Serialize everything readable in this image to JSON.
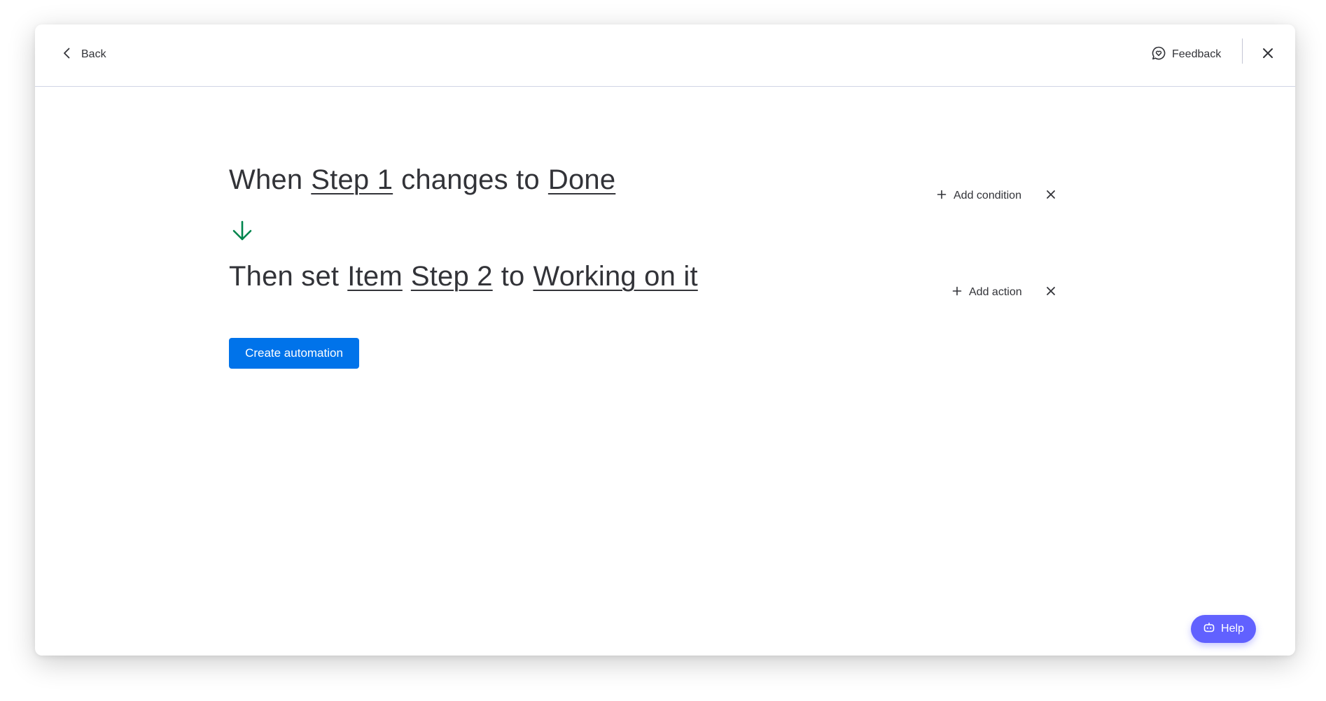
{
  "header": {
    "back_label": "Back",
    "feedback_label": "Feedback"
  },
  "recipe": {
    "trigger": {
      "prefix": "When",
      "column": "Step 1",
      "middle": "changes to",
      "value": "Done",
      "add_label": "Add condition"
    },
    "action": {
      "prefix": "Then set",
      "target": "Item",
      "column": "Step 2",
      "middle": "to",
      "value": "Working on it",
      "add_label": "Add action"
    }
  },
  "create_button_label": "Create automation",
  "help_label": "Help",
  "colors": {
    "primary": "#0073ea",
    "arrow": "#00854d",
    "help": "#6161ff",
    "text": "#323338"
  },
  "icons": {
    "back": "chevron-left-icon",
    "feedback": "chat-heart-icon",
    "close": "close-icon",
    "arrow": "arrow-down-icon",
    "add": "plus-icon",
    "help": "robot-icon"
  }
}
